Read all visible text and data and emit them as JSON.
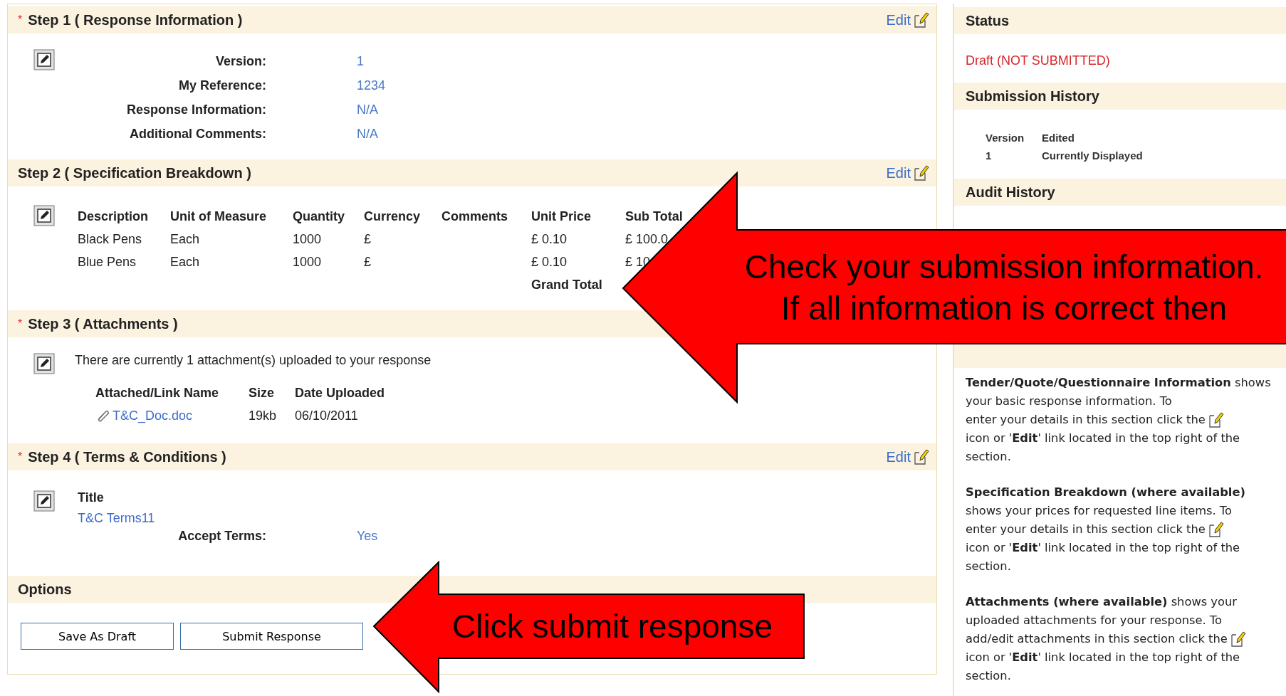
{
  "steps": [
    {
      "kind": "fields",
      "required_mark": "*",
      "title": "Step 1 ( Response Information )",
      "edit_label": "Edit",
      "fields": [
        {
          "label": "Version:",
          "value": "1"
        },
        {
          "label": "My Reference:",
          "value": "1234"
        },
        {
          "label": "Response Information:",
          "value": "N/A"
        },
        {
          "label": "Additional Comments:",
          "value": "N/A"
        }
      ]
    },
    {
      "kind": "table",
      "title": "Step 2 ( Specification Breakdown )",
      "edit_label": "Edit",
      "columns": [
        "Description",
        "Unit of Measure",
        "Quantity",
        "Currency",
        "Comments",
        "Unit Price",
        "Sub Total"
      ],
      "rows": [
        [
          "Black Pens",
          "Each",
          "1000",
          "£",
          null,
          "£ 0.10",
          "£ 100.0"
        ],
        [
          "Blue Pens",
          "Each",
          "1000",
          "£",
          null,
          "£ 0.10",
          "£ 10"
        ]
      ],
      "total_label": "Grand Total"
    },
    {
      "kind": "attachments",
      "required_mark": "*",
      "title": "Step 3 ( Attachments )",
      "message": "There are currently 1 attachment(s) uploaded to your response",
      "columns": [
        "Attached/Link Name",
        "Size",
        "Date Uploaded"
      ],
      "rows": [
        {
          "name": "T&C_Doc.doc",
          "size": "19kb",
          "date": "06/10/2011"
        }
      ]
    },
    {
      "kind": "terms",
      "required_mark": "*",
      "title": "Step 4 ( Terms & Conditions )",
      "edit_label": "Edit",
      "heading": "Title",
      "link": "T&C Terms11",
      "fields": [
        {
          "label": "Accept Terms:",
          "value": "Yes"
        }
      ]
    },
    {
      "kind": "options",
      "title": "Options",
      "buttons": [
        "Save As Draft",
        "Submit Response"
      ]
    }
  ],
  "sidebar": {
    "status": {
      "title": "Status",
      "value": "Draft (NOT SUBMITTED)"
    },
    "history": {
      "title": "Submission History",
      "columns": [
        "Version",
        "Edited"
      ],
      "rows": [
        [
          "1",
          "Currently Displayed"
        ]
      ]
    },
    "audit": {
      "title": "Audit History"
    },
    "help": [
      {
        "before": "**Tender/Quote/Questionnaire Information** shows your basic response information. To",
        "icon_line": "enter your details in this section click the",
        "after": "icon or '**Edit**' link located in the top right of the section."
      },
      {
        "before": "**Specification Breakdown (where available)** shows your prices for requested line items. To",
        "icon_line": "enter your details in this section click the",
        "after": "icon or '**Edit**' link located in the top right of the section."
      },
      {
        "before": "**Attachments (where available)** shows your uploaded attachments for your response. To",
        "icon_line": "add/edit attachments in this section click the",
        "after": "icon or '**Edit**' link located in the top right of the section."
      }
    ]
  },
  "callouts": [
    {
      "lines": [
        "Check your submission information.",
        "If all information is correct then"
      ]
    },
    {
      "lines": [
        "Click submit response"
      ]
    }
  ]
}
